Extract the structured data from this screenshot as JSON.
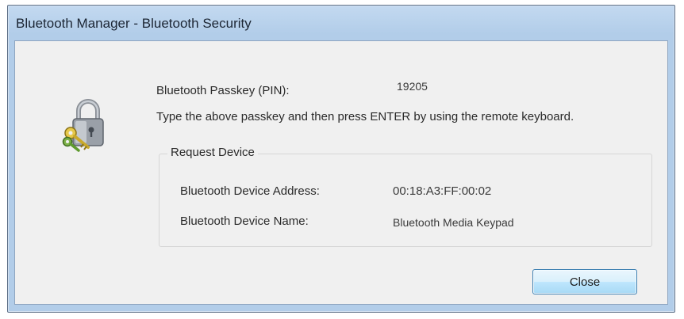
{
  "window": {
    "title": "Bluetooth Manager - Bluetooth Security"
  },
  "icon": {
    "name": "lock-with-keys-icon"
  },
  "passkey": {
    "label": "Bluetooth Passkey (PIN):",
    "value": "19205"
  },
  "instructions": "Type the above passkey and then press ENTER by using the remote keyboard.",
  "request_device": {
    "title": "Request Device",
    "address_label": "Bluetooth Device Address:",
    "address_value": "00:18:A3:FF:00:02",
    "name_label": "Bluetooth Device Name:",
    "name_value": "Bluetooth Media Keypad"
  },
  "buttons": {
    "close": "Close"
  },
  "colors": {
    "titlebar": "#b9d3ee",
    "client_background": "#f0f0f0",
    "button_border": "#3c7fb1"
  }
}
